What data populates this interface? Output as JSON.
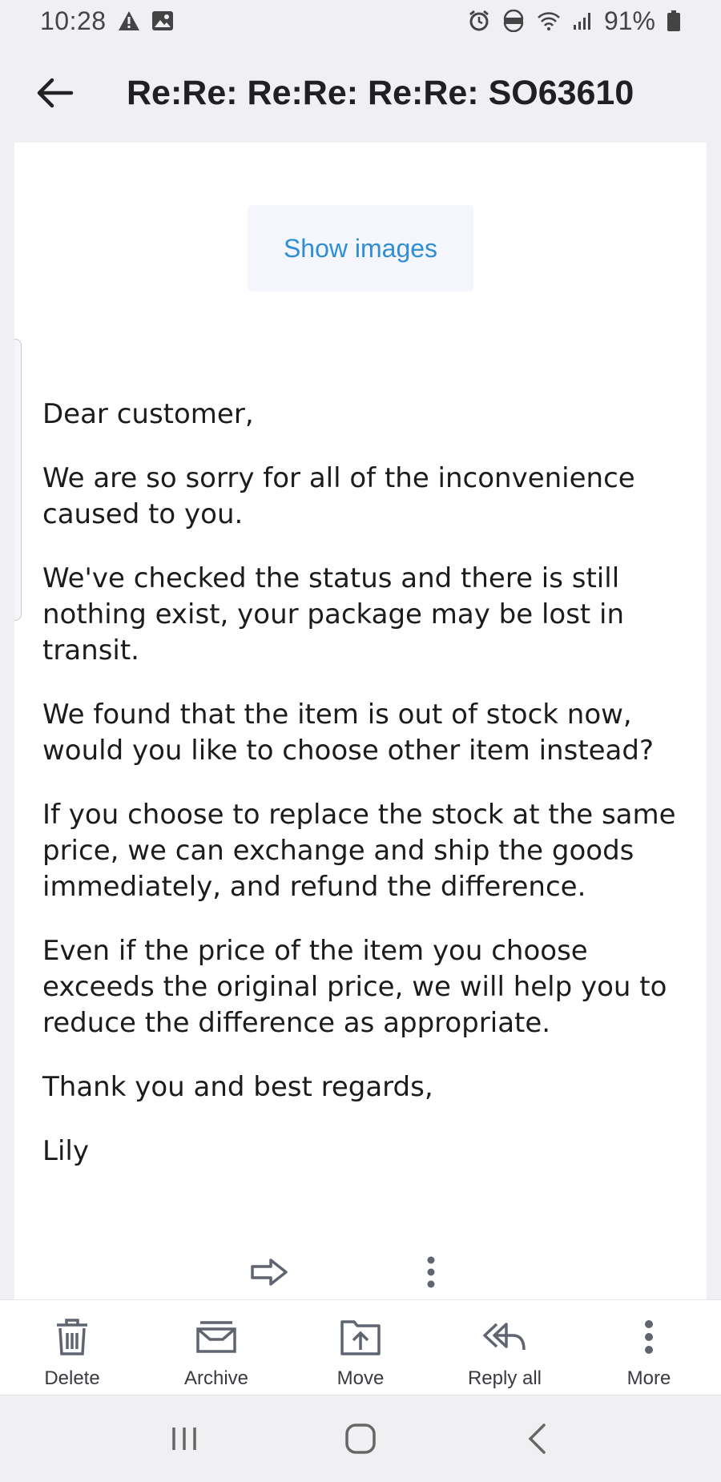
{
  "status_bar": {
    "time": "10:28",
    "battery": "91%",
    "left_icons": [
      "warning-icon",
      "image-icon"
    ],
    "right_icons": [
      "alarm-icon",
      "volte-icon",
      "wifi-icon",
      "signal-icon",
      "battery-icon"
    ]
  },
  "header": {
    "subject": "Re:Re: Re:Re: Re:Re: SO63610"
  },
  "email": {
    "show_images_label": "Show images",
    "paragraphs": [
      "Dear customer,",
      "We are so sorry for all of the inconvenience caused to you.",
      "We've checked the status and there is still nothing exist, your package may be lost in transit.",
      "We found that the item is out of stock now, would you like to choose other item instead?",
      "If you choose to replace the stock at the same price, we can exchange and ship the goods immediately, and refund the difference.",
      "Even if the price of the item you choose exceeds the original price, we will help you to reduce the difference as appropriate.",
      "Thank you and best regards,",
      "Lily"
    ]
  },
  "toolbar": {
    "delete_label": "Delete",
    "archive_label": "Archive",
    "move_label": "Move",
    "reply_all_label": "Reply all",
    "more_label": "More"
  },
  "colors": {
    "background": "#f0f0f4",
    "accent": "#2f8fd6",
    "icon": "#5f6470"
  }
}
